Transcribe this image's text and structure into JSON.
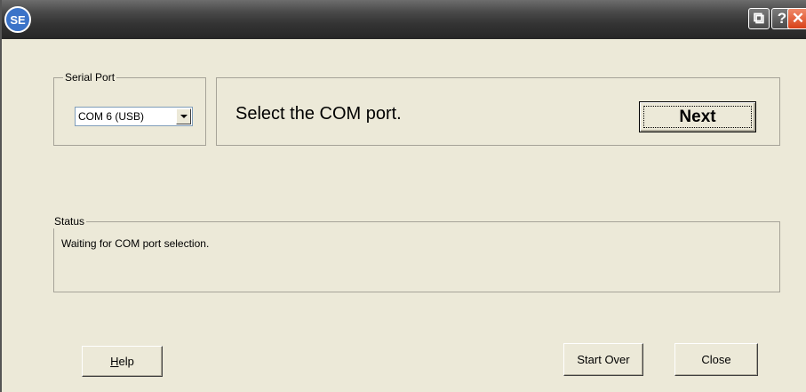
{
  "titlebar": {
    "app_icon_text": "SE",
    "restore_glyph": "⧉",
    "help_glyph": "?",
    "close_glyph": "✕"
  },
  "serial_port": {
    "group_label": "Serial Port",
    "selected_value": "COM 6 (USB)"
  },
  "prompt": {
    "text": "Select the COM port.",
    "next_label": "Next"
  },
  "status": {
    "group_label": "Status",
    "message": "Waiting for COM port selection."
  },
  "footer": {
    "help_mnemonic": "H",
    "help_rest": "elp",
    "start_over_label": "Start Over",
    "close_label": "Close"
  },
  "colors": {
    "dialog_bg": "#ece9d8",
    "titlebar": "#2e2e2e",
    "close_button": "#d84118"
  }
}
